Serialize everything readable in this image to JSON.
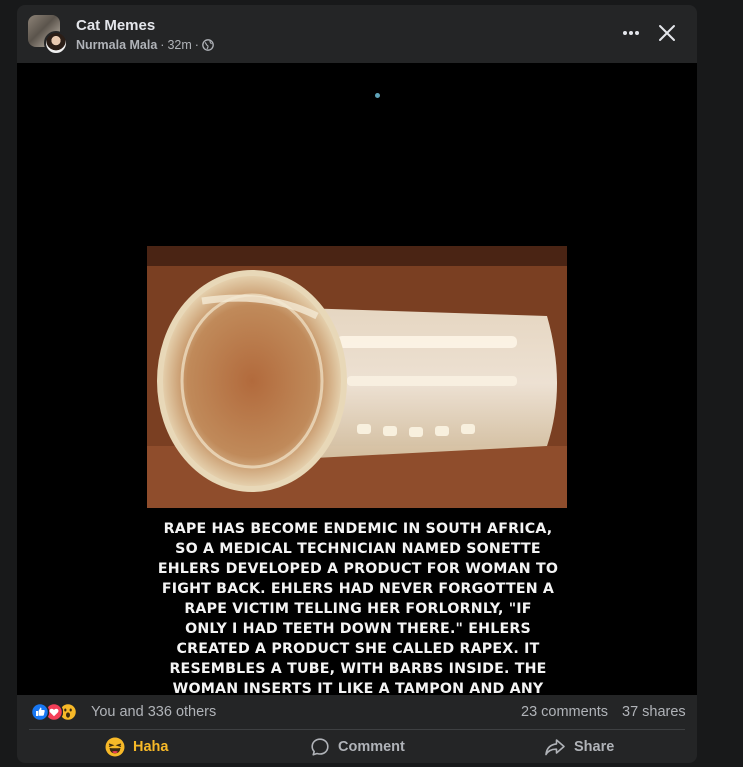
{
  "post": {
    "group_name": "Cat Memes",
    "author": "Nurmala Mala",
    "time": "32m",
    "separator": "·"
  },
  "meme": {
    "lines": [
      "RAPE HAS BECOME ENDEMIC IN SOUTH AFRICA,",
      "SO A MEDICAL TECHNICIAN NAMED SONETTE",
      "EHLERS DEVELOPED A PRODUCT FOR WOMAN TO",
      "FIGHT BACK. EHLERS HAD NEVER FORGOTTEN A",
      "RAPE VICTIM TELLING HER FORLORNLY, \"IF",
      "ONLY I HAD TEETH DOWN THERE.\" EHLERS",
      "CREATED A PRODUCT SHE CALLED RAPEX. IT",
      "RESEMBLES A TUBE, WITH BARBS INSIDE. THE",
      "WOMAN INSERTS IT LIKE A TAMPON AND ANY"
    ]
  },
  "stats": {
    "reactions_text": "You and 336 others",
    "comments": "23 comments",
    "shares": "37 shares"
  },
  "actions": {
    "haha": "Haha",
    "comment": "Comment",
    "share": "Share"
  },
  "icons": {
    "like": "like-reaction-icon",
    "love": "love-reaction-icon",
    "wow": "wow-reaction-icon"
  },
  "colors": {
    "card_bg": "#242526",
    "page_bg": "#18191a",
    "secondary_text": "#b0b3b8",
    "haha_active": "#f7b928",
    "like_blue": "#1877f2",
    "love_red": "#f33e58"
  }
}
